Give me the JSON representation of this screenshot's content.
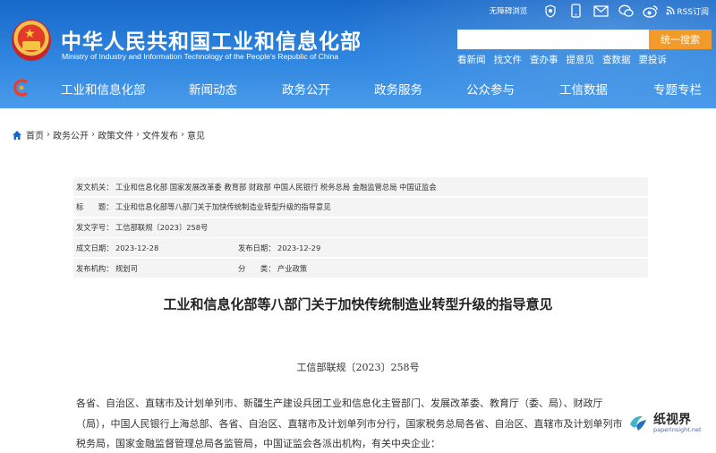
{
  "header": {
    "site_title": "中华人民共和国工业和信息化部",
    "site_subtitle": "Ministry of Industry and Information Technology of the People's Republic of China",
    "top_links": {
      "barrier_free": "无障碍浏览",
      "rss": "RSS订阅"
    },
    "search": {
      "placeholder": "",
      "button_label": "统一搜索"
    },
    "quick_links": [
      "看新闻",
      "找文件",
      "查办事",
      "提意见",
      "查数据",
      "要投诉"
    ],
    "nav": [
      "工业和信息化部",
      "新闻动态",
      "政务公开",
      "政务服务",
      "公众参与",
      "工信数据",
      "专题专栏"
    ]
  },
  "breadcrumb": {
    "items": [
      "首页",
      "政务公开",
      "政策文件",
      "文件发布"
    ],
    "separator": "›",
    "current": "意见"
  },
  "doc_info": {
    "issuer_label": "发文机关：",
    "issuer": "工业和信息化部 国家发展改革委 教育部 财政部 中国人民银行 税务总局 金融监管总局 中国证监会",
    "title_label": "标　　题：",
    "title": "工业和信息化部等八部门关于加快传统制造业转型升级的指导意见",
    "doc_no_label": "发文字号：",
    "doc_no": "工信部联规〔2023〕258号",
    "created_label": "成文日期：",
    "created": "2023-12-28",
    "published_label": "发布日期：",
    "published": "2023-12-29",
    "org_label": "发布机构：",
    "org": "规划司",
    "category_label": "分　　类：",
    "category": "产业政策"
  },
  "article": {
    "title": "工业和信息化部等八部门关于加快传统制造业转型升级的指导意见",
    "doc_number": "工信部联规〔2023〕258号",
    "lines": [
      "各省、自治区、直辖市及计划单列市、新疆生产建设兵团工业和信息化主管部门、发展改革委、教育厅（委、局）、财政厅",
      "（局），中国人民银行上海总部、各省、自治区、直辖市及计划单列市分行，国家税务总局各省、自治区、直辖市及计划单列市",
      "税务局，国家金融监督管理总局各监管局，中国证监会各派出机构，有关中央企业："
    ]
  },
  "watermark": {
    "name": "纸视界",
    "url": "paperinsight.net"
  },
  "colors": {
    "header_blue": "#2f86e0",
    "search_orange": "#f29b2b",
    "link_blue": "#1768c9"
  }
}
